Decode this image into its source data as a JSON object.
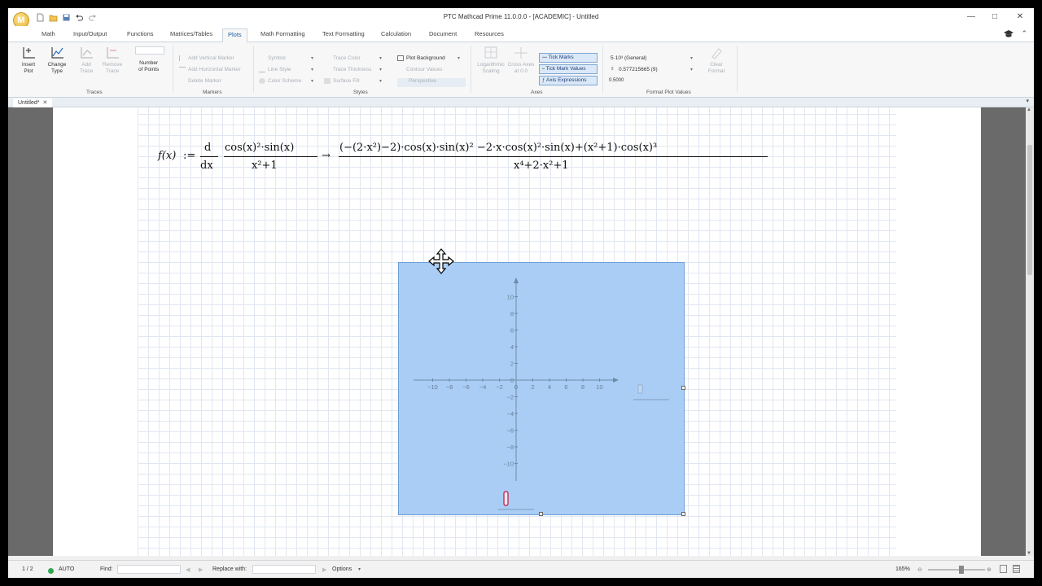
{
  "window": {
    "title": "PTC Mathcad Prime 11.0.0.0 - [ACADEMIC] - Untitled",
    "logo_letter": "M"
  },
  "tabs": [
    "Math",
    "Input/Output",
    "Functions",
    "Matrices/Tables",
    "Plots",
    "Math Formatting",
    "Text Formatting",
    "Calculation",
    "Document",
    "Resources"
  ],
  "active_tab": "Plots",
  "ribbon": {
    "traces": {
      "insert_plot": "Insert\nPlot",
      "change_type": "Change\nType",
      "add_trace": "Add\nTrace",
      "remove_trace": "Remove\nTrace",
      "number_of_points": "Number\nof Points",
      "group_label": "Traces"
    },
    "markers": {
      "add_vertical": "Add Vertical Marker",
      "add_horizontal": "Add Horizontal Marker",
      "delete": "Delete Marker",
      "group_label": "Markers"
    },
    "styles": {
      "symbol": "Symbol",
      "line_style": "Line Style",
      "color_scheme": "Color Scheme",
      "trace_color": "Trace Color",
      "trace_thickness": "Trace Thickness",
      "surface_fill": "Surface Fill",
      "plot_background": "Plot Background",
      "contour_values": "Contour Values",
      "perspective": "Perspective",
      "group_label": "Styles"
    },
    "axes": {
      "logarithmic_scaling": "Logarithmic\nScaling",
      "cross_axes": "Cross Axes\nat 0.0",
      "tick_marks": "Tick Marks",
      "tick_mark_values": "Tick Mark Values",
      "axis_expressions": "Axis Expressions",
      "group_label": "Axes"
    },
    "format_values": {
      "format": "5·10³ (General)",
      "precision": "0.577215665 (9)",
      "value": "0.5000",
      "clear_format": "Clear\nFormat",
      "group_label": "Format Plot Values"
    }
  },
  "document_tab": {
    "label": "Untitled*"
  },
  "worksheet": {
    "definition": {
      "lhs": "f(x)",
      "assign": ":=",
      "deriv_num": "d",
      "deriv_den": "dx",
      "frac_num": "cos(x)²·sin(x)",
      "frac_den": "x²+1",
      "arrow": "→",
      "result_num": "(−(2·x²)−2)·cos(x)·sin(x)² −2·x·cos(x)²·sin(x)+(x²+1)·cos(x)³",
      "result_den": "x⁴+2·x²+1"
    }
  },
  "plot": {
    "x_ticks": [
      "−10",
      "−8",
      "−6",
      "−4",
      "−2",
      "0",
      "2",
      "4",
      "6",
      "8",
      "10"
    ],
    "y_ticks": [
      "10",
      "8",
      "6",
      "4",
      "2",
      "0",
      "−2",
      "−4",
      "−6",
      "−8",
      "−10"
    ],
    "background": "#a9cdf5"
  },
  "statusbar": {
    "page": "1 / 2",
    "calc_mode": "AUTO",
    "find_label": "Find:",
    "replace_label": "Replace with:",
    "options": "Options",
    "zoom": "165%"
  }
}
